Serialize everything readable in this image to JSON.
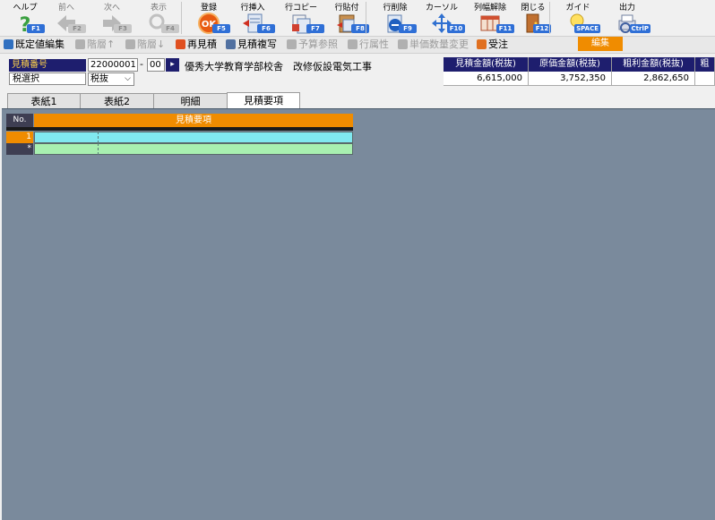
{
  "toolbar": [
    {
      "label": "ヘルプ",
      "key": "F1",
      "icon": "help-icon",
      "enabled": true
    },
    {
      "label": "前へ",
      "key": "F2",
      "icon": "arrow-left-icon",
      "enabled": false
    },
    {
      "label": "次へ",
      "key": "F3",
      "icon": "arrow-right-icon",
      "enabled": false
    },
    {
      "label": "表示",
      "key": "F4",
      "icon": "magnifier-icon",
      "enabled": false
    },
    {
      "label": "登録",
      "key": "F5",
      "icon": "ok-icon",
      "enabled": true
    },
    {
      "label": "行挿入",
      "key": "F6",
      "icon": "row-insert-icon",
      "enabled": true
    },
    {
      "label": "行コピー",
      "key": "F7",
      "icon": "row-copy-icon",
      "enabled": true
    },
    {
      "label": "行貼付",
      "key": "F8",
      "icon": "row-paste-icon",
      "enabled": true
    },
    {
      "label": "行削除",
      "key": "F9",
      "icon": "row-delete-icon",
      "enabled": true
    },
    {
      "label": "カーソル",
      "key": "F10",
      "icon": "cursor-icon",
      "enabled": true
    },
    {
      "label": "列幅解除",
      "key": "F11",
      "icon": "column-width-icon",
      "enabled": true
    },
    {
      "label": "閉じる",
      "key": "F12",
      "icon": "door-icon",
      "enabled": true
    },
    {
      "label": "ガイド",
      "key": "SPACE",
      "icon": "lightbulb-icon",
      "enabled": true
    },
    {
      "label": "出力",
      "key": "CtrlP",
      "icon": "output-icon",
      "enabled": true
    }
  ],
  "commands": [
    {
      "label": "既定値編集",
      "enabled": true
    },
    {
      "label": "階層↑",
      "enabled": false
    },
    {
      "label": "階層↓",
      "enabled": false
    },
    {
      "label": "再見積",
      "enabled": true
    },
    {
      "label": "見積複写",
      "enabled": true
    },
    {
      "label": "予算参照",
      "enabled": false
    },
    {
      "label": "行属性",
      "enabled": false
    },
    {
      "label": "単価数量変更",
      "enabled": false
    },
    {
      "label": "受注",
      "enabled": true
    }
  ],
  "edit_button": "編集",
  "header": {
    "estimate_no_label": "見積番号",
    "estimate_no": "22000001",
    "dash": "-",
    "branch_no": "00",
    "project_name": "優秀大学教育学部校舎　改修仮設電気工事",
    "tax_label": "税選択",
    "tax_value": "税抜"
  },
  "summary": {
    "headers": [
      "見積金額(税抜)",
      "原価金額(税抜)",
      "粗利金額(税抜)",
      "粗"
    ],
    "values": [
      "6,615,000",
      "3,752,350",
      "2,862,650",
      ""
    ]
  },
  "tabs": [
    {
      "label": "表紙1",
      "active": false
    },
    {
      "label": "表紙2",
      "active": false
    },
    {
      "label": "明細",
      "active": false
    },
    {
      "label": "見積要項",
      "active": true
    }
  ],
  "grid": {
    "no_header": "No.",
    "title_header": "見積要項",
    "rows": [
      {
        "no": "1",
        "kind": "data"
      },
      {
        "no": "*",
        "kind": "new"
      }
    ]
  },
  "colors": {
    "accent_orange": "#f08c00",
    "header_navy": "#1e1e6e",
    "workarea": "#7a8a9c",
    "row_cyan": "#80e8f0",
    "row_green": "#a8f0b0",
    "key_blue": "#2f6fd6"
  }
}
